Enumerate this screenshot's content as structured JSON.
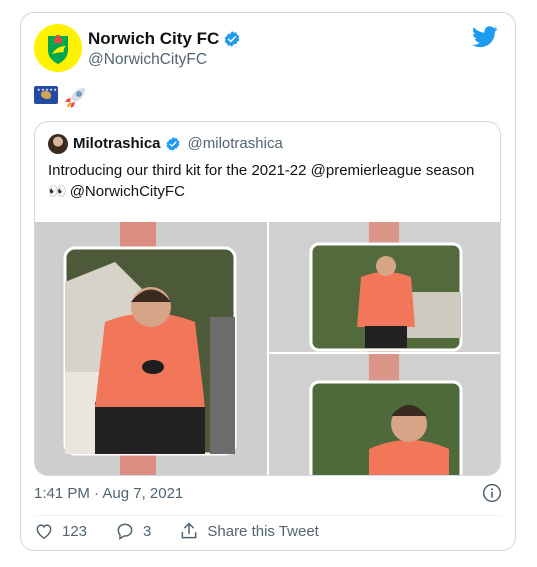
{
  "tweet": {
    "author_name": "Norwich City FC",
    "author_handle": "@NorwichCityFC",
    "emojis": [
      "kosovo-flag",
      "rocket"
    ],
    "timestamp": "1:41 PM · Aug 7, 2021"
  },
  "quoted": {
    "author_name": "Milotrashica",
    "author_handle": "@milotrashica",
    "text_line1": "Introducing our third kit for the 2021-22 @premierleague season",
    "text_line2": "@NorwichCityFC",
    "eyes_emoji": "👀"
  },
  "actions": {
    "likes": "123",
    "replies": "3",
    "share_label": "Share this Tweet"
  },
  "colors": {
    "twitter_blue": "#1d9bf0",
    "kit_orange": "#f2765a",
    "text_secondary": "#536471"
  }
}
